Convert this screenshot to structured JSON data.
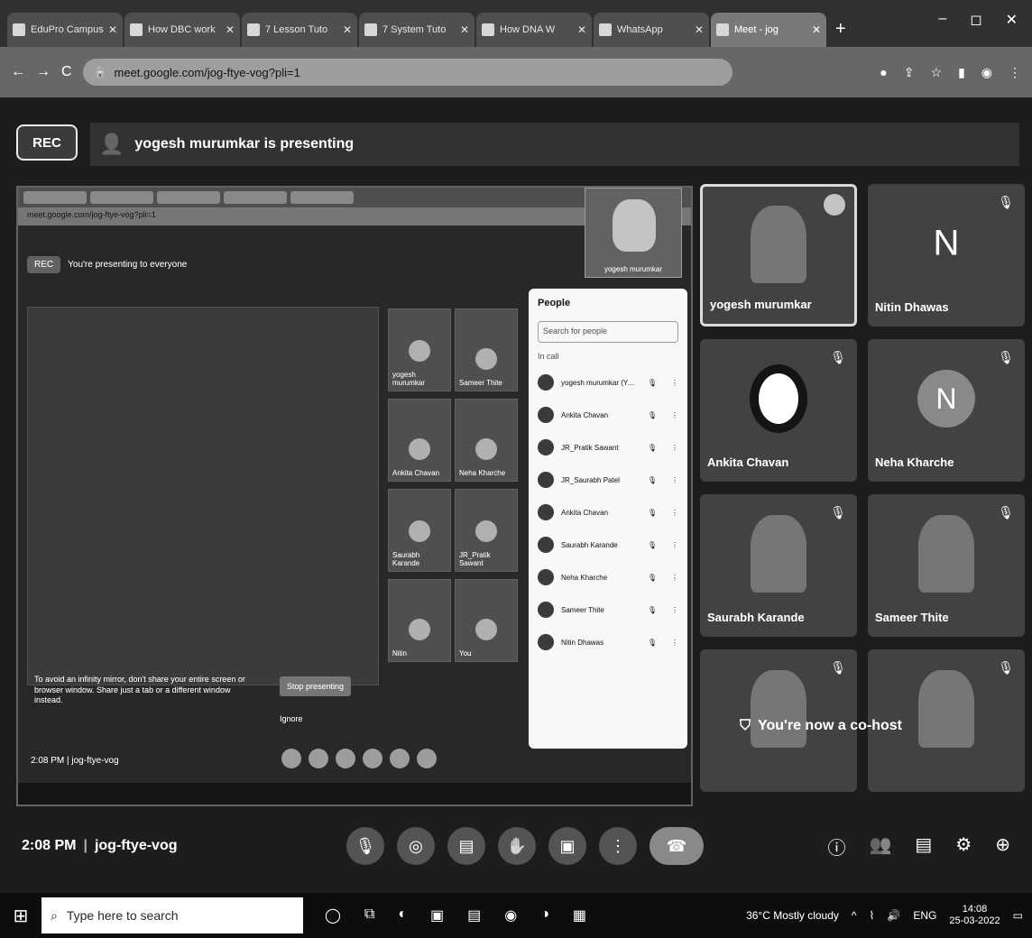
{
  "browser": {
    "tabs": [
      {
        "label": "EduPro Campus",
        "active": false
      },
      {
        "label": "How DBC work",
        "active": false
      },
      {
        "label": "7 Lesson Tuto",
        "active": false
      },
      {
        "label": "7 System Tuto",
        "active": false
      },
      {
        "label": "How DNA W",
        "active": false
      },
      {
        "label": "WhatsApp",
        "active": false
      },
      {
        "label": "Meet - jog",
        "active": true
      }
    ],
    "new_tab": "+",
    "window_controls": {
      "min": "–",
      "max": "◻",
      "close": "✕"
    },
    "url": "meet.google.com/jog-ftye-vog?pli=1",
    "nav": {
      "back": "←",
      "forward": "→",
      "reload": "C"
    }
  },
  "meet": {
    "rec_label": "REC",
    "presenting_banner": "yogesh murumkar is presenting",
    "shared_screen": {
      "banner": "You're presenting to everyone",
      "stop_label": "Stop presenting",
      "people_title": "People",
      "search_placeholder": "Search for people",
      "in_call_label": "In call",
      "people": [
        "yogesh murumkar (You)",
        "Ankita Chavan",
        "JR_Pratik Sawant",
        "JR_Saurabh Patel",
        "Ankita Chavan",
        "Saurabh Karande",
        "Neha Kharche",
        "Sameer Thite",
        "Nitin Dhawas"
      ],
      "tiles": [
        "yogesh murumkar",
        "Sameer Thite",
        "Ankita Chavan",
        "Neha Kharche",
        "Saurabh Karande",
        "JR_Pratik Sawant",
        "Nitin",
        "You"
      ],
      "warning": "To avoid an infinity mirror, don't share your entire screen or browser window. Share just a tab or a different window instead.",
      "stop_presenting": "Stop presenting",
      "ignore": "Ignore",
      "footer": "2:08 PM | jog-ftye-vog",
      "pip_name": "yogesh murumkar"
    },
    "tiles": [
      {
        "name": "yogesh murumkar",
        "kind": "photo",
        "speaking": true
      },
      {
        "name": "Nitin Dhawas",
        "kind": "letter",
        "letter": "N"
      },
      {
        "name": "Ankita Chavan",
        "kind": "ring"
      },
      {
        "name": "Neha Kharche",
        "kind": "circle",
        "letter": "N"
      },
      {
        "name": "Saurabh Karande",
        "kind": "photo"
      },
      {
        "name": "Sameer Thite",
        "kind": "photo"
      },
      {
        "name": "",
        "kind": "photo"
      },
      {
        "name": "",
        "kind": "photo"
      }
    ],
    "cohost_toast": "You're now a co-host",
    "bottom": {
      "time": "2:08 PM",
      "separator": "|",
      "meeting_code": "jog-ftye-vog"
    },
    "controls": [
      {
        "name": "mic-icon",
        "glyph": "🎙"
      },
      {
        "name": "camera-icon",
        "glyph": "◎"
      },
      {
        "name": "captions-icon",
        "glyph": "▤"
      },
      {
        "name": "raise-hand-icon",
        "glyph": "✋"
      },
      {
        "name": "present-icon",
        "glyph": "▣"
      },
      {
        "name": "more-options-icon",
        "glyph": "⋮"
      },
      {
        "name": "leave-call-icon",
        "glyph": "☎"
      }
    ],
    "right_controls": [
      "ⓘ",
      "👥",
      "▤",
      "⚙",
      "⊕"
    ]
  },
  "taskbar": {
    "search_placeholder": "Type here to search",
    "weather": "36°C Mostly cloudy",
    "lang": "ENG",
    "time": "14:08",
    "date": "25-03-2022"
  }
}
